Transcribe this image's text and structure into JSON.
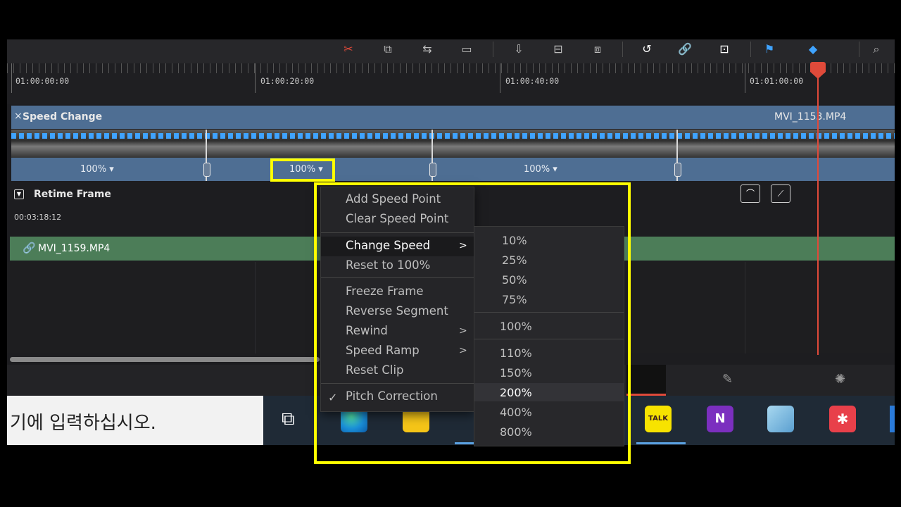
{
  "timeline": {
    "timecodes": [
      "01:00:00:00",
      "01:00:20:00",
      "01:00:40:00",
      "01:01:00:00"
    ]
  },
  "clip": {
    "title": "Speed Change",
    "right_name": "MVI_115​3.MP4",
    "speeds": [
      "100%",
      "100%",
      "100%"
    ]
  },
  "retime": {
    "label": "Retime Frame",
    "timecode": "00:03:18:12"
  },
  "audio": {
    "name": "MVI_1159.MP4"
  },
  "context_menu": {
    "items": [
      {
        "label": "Add Speed Point"
      },
      {
        "label": "Clear Speed Point"
      },
      {
        "label": "Change Speed"
      },
      {
        "label": "Reset to 100%"
      },
      {
        "label": "Freeze Frame"
      },
      {
        "label": "Reverse Segment"
      },
      {
        "label": "Rewind"
      },
      {
        "label": "Speed Ramp"
      },
      {
        "label": "Reset Clip"
      },
      {
        "label": "Pitch Correction"
      }
    ]
  },
  "speed_submenu": {
    "options": [
      "10%",
      "25%",
      "50%",
      "75%",
      "100%",
      "110%",
      "150%",
      "200%",
      "400%",
      "800%"
    ],
    "highlighted": "200%"
  },
  "taskbar": {
    "search_text": "기에 입력하십시오."
  },
  "colors": {
    "highlight_box": "#ffff00",
    "playhead": "#e04a3a",
    "clip": "#4e6e93",
    "audio_track": "#4c7d58"
  }
}
